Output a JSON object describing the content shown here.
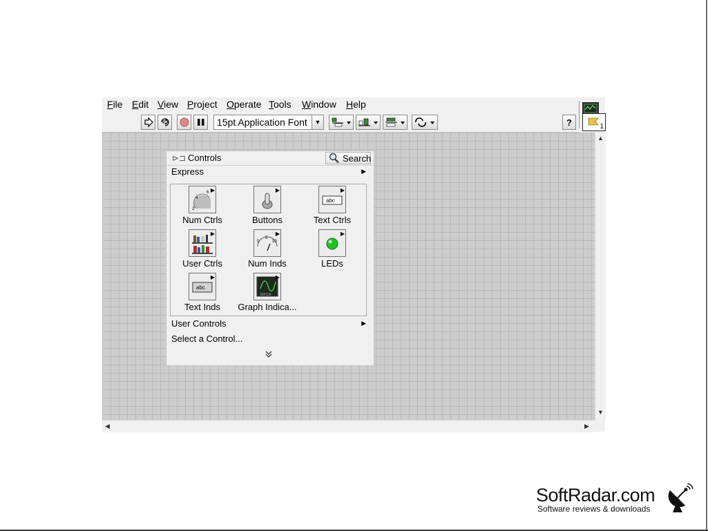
{
  "menubar": {
    "items": [
      {
        "label": "File",
        "accel": "F",
        "rest": "ile"
      },
      {
        "label": "Edit",
        "accel": "E",
        "rest": "dit"
      },
      {
        "label": "View",
        "accel": "V",
        "rest": "iew"
      },
      {
        "label": "Project",
        "accel": "P",
        "rest": "roject"
      },
      {
        "label": "Operate",
        "accel": "O",
        "rest": "perate"
      },
      {
        "label": "Tools",
        "accel": "T",
        "rest": "ools"
      },
      {
        "label": "Window",
        "accel": "W",
        "rest": "indow"
      },
      {
        "label": "Help",
        "accel": "H",
        "rest": "elp"
      }
    ]
  },
  "toolbar": {
    "font_label": "15pt Application Font",
    "connector_number": "1",
    "icons": [
      "run-arrow-icon",
      "run-continuously-icon",
      "abort-icon",
      "pause-icon",
      "align-icon",
      "distribute-icon",
      "resize-icon",
      "reorder-icon",
      "help-icon"
    ]
  },
  "palette": {
    "title": "Controls",
    "search_label": "Search",
    "categories": {
      "express": "Express",
      "user_controls": "User Controls",
      "select": "Select a Control..."
    },
    "items": [
      {
        "label": "Num Ctrls",
        "icon": "knob-icon"
      },
      {
        "label": "Buttons",
        "icon": "toggle-switch-icon"
      },
      {
        "label": "Text Ctrls",
        "icon": "abc-field-icon"
      },
      {
        "label": "User Ctrls",
        "icon": "shelves-icon"
      },
      {
        "label": "Num Inds",
        "icon": "meter-icon"
      },
      {
        "label": "LEDs",
        "icon": "green-led-icon"
      },
      {
        "label": "Text Inds",
        "icon": "abc-indicator-icon"
      },
      {
        "label": "Graph Indica...",
        "icon": "graph-icon"
      }
    ],
    "led_color": "#21c321"
  },
  "watermark": {
    "name": "SoftRadar.com",
    "tagline": "Software reviews & downloads"
  }
}
